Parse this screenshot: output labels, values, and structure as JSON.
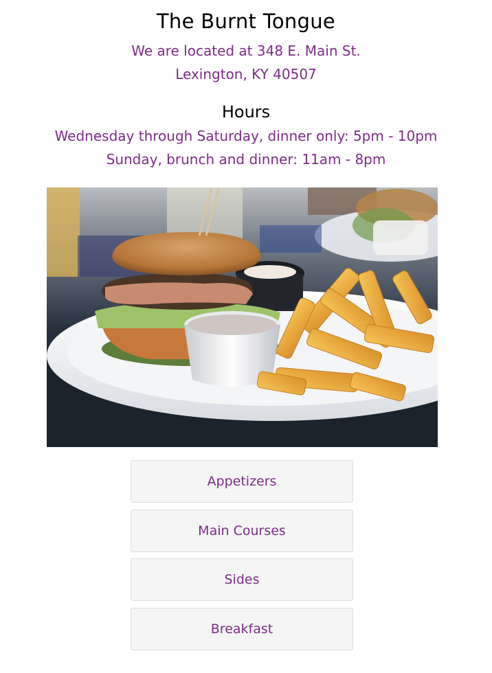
{
  "restaurant": {
    "name": "The Burnt Tongue",
    "address_line1": "We are located at 348 E. Main St.",
    "address_line2": "Lexington, KY 40507"
  },
  "hours": {
    "heading": "Hours",
    "line1": "Wednesday through Saturday, dinner only: 5pm - 10pm",
    "line2": "Sunday, brunch and dinner: 11am - 8pm"
  },
  "menu": {
    "buttons": [
      "Appetizers",
      "Main Courses",
      "Sides",
      "Breakfast"
    ]
  },
  "colors": {
    "accent": "#7b2d86",
    "button_bg": "#f5f5f5"
  }
}
